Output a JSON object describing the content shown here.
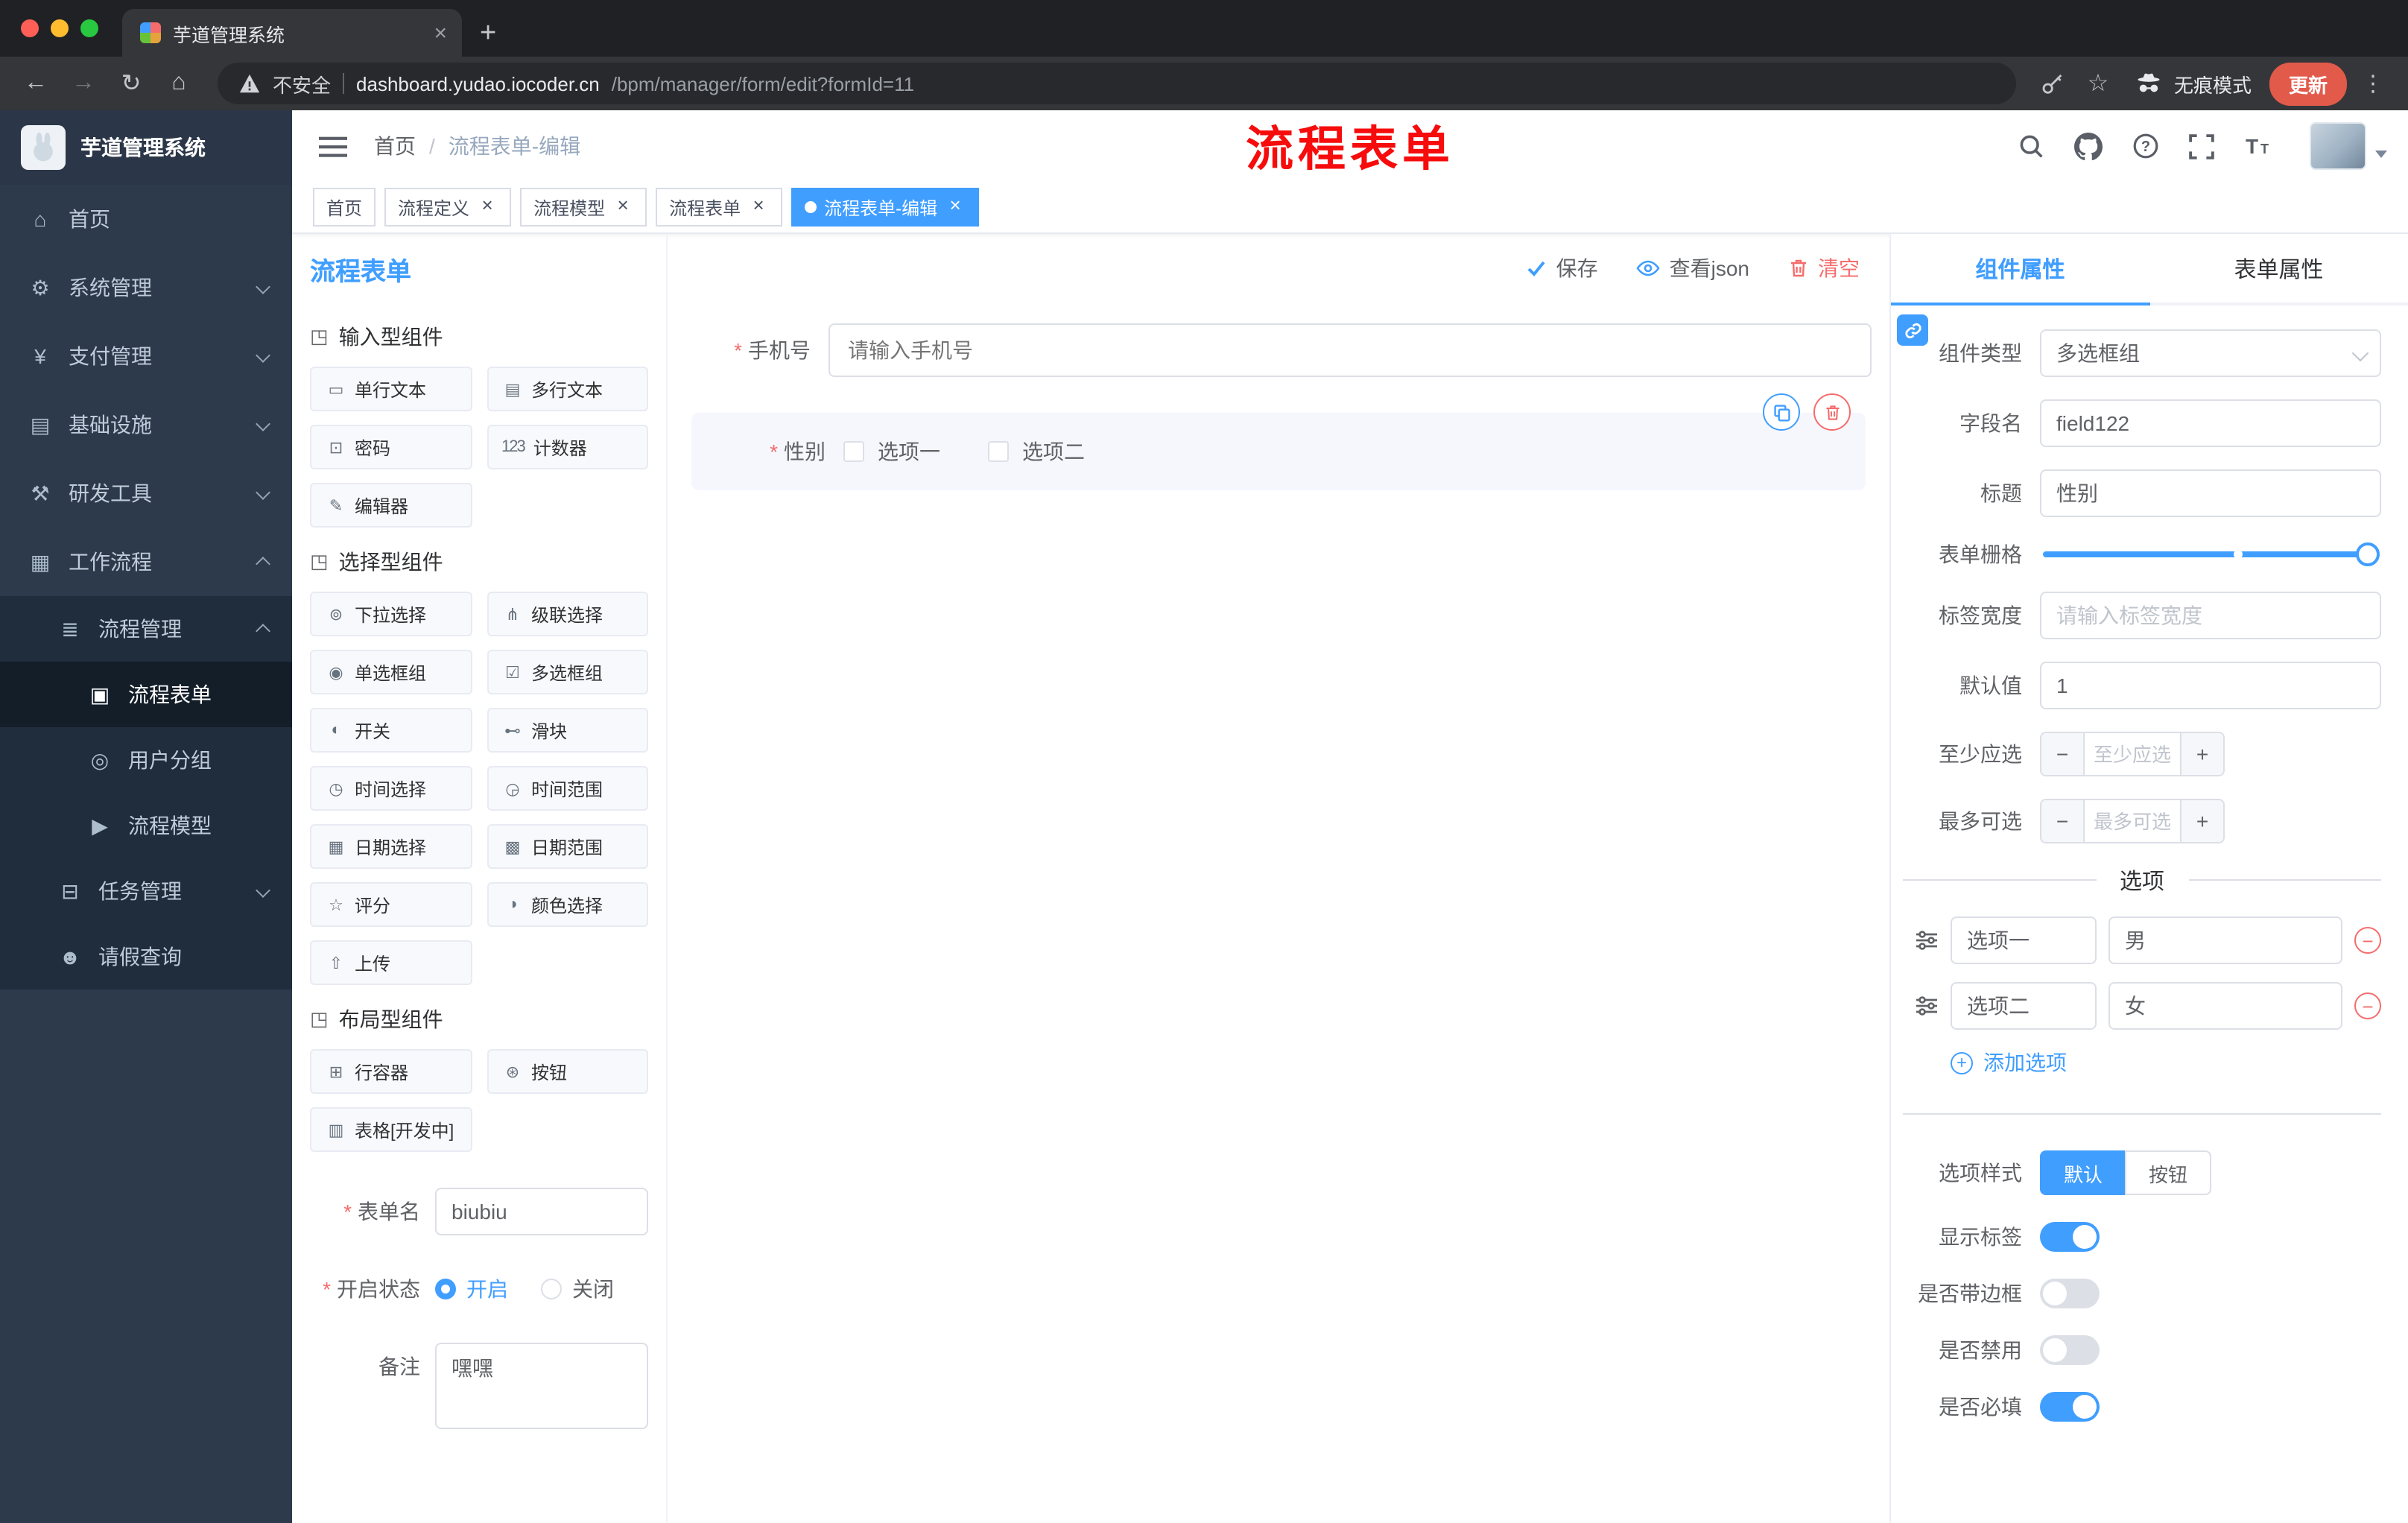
{
  "theme": {
    "accent": "#409EFF",
    "danger": "#F56C6C",
    "annotation_red": "#F60C0C",
    "sidebar_bg": "#2D3A4B"
  },
  "browser": {
    "tab_title": "芋道管理系统",
    "security_label": "不安全",
    "url_domain": "dashboard.yudao.iocoder.cn",
    "url_path": "/bpm/manager/form/edit?formId=11",
    "incognito_label": "无痕模式",
    "update_label": "更新"
  },
  "sidebar": {
    "logo_title": "芋道管理系统",
    "menu": [
      {
        "label": "首页",
        "icon": "home-icon"
      },
      {
        "label": "系统管理",
        "icon": "gear-icon"
      },
      {
        "label": "支付管理",
        "icon": "yen-icon"
      },
      {
        "label": "基础设施",
        "icon": "infra-icon"
      },
      {
        "label": "研发工具",
        "icon": "tool-icon"
      },
      {
        "label": "工作流程",
        "icon": "workflow-icon"
      },
      {
        "label": "流程管理",
        "icon": "list-icon"
      },
      {
        "label": "流程表单",
        "icon": "form-icon"
      },
      {
        "label": "用户分组",
        "icon": "users-icon"
      },
      {
        "label": "流程模型",
        "icon": "send-icon"
      },
      {
        "label": "任务管理",
        "icon": "task-icon"
      },
      {
        "label": "请假查询",
        "icon": "person-icon"
      }
    ]
  },
  "header": {
    "breadcrumb_home": "首页",
    "breadcrumb_sep": "/",
    "breadcrumb_current": "流程表单-编辑",
    "annotation": "流程表单"
  },
  "tags": [
    {
      "label": "首页"
    },
    {
      "label": "流程定义"
    },
    {
      "label": "流程模型"
    },
    {
      "label": "流程表单"
    },
    {
      "label": "流程表单-编辑"
    }
  ],
  "palette": {
    "title": "流程表单",
    "group_icon": "cube-icon",
    "group_input": "输入型组件",
    "group_select": "选择型组件",
    "group_layout": "布局型组件",
    "input_items": [
      {
        "label": "单行文本",
        "icon": "input-icon"
      },
      {
        "label": "多行文本",
        "icon": "textarea-icon"
      },
      {
        "label": "密码",
        "icon": "password-icon"
      },
      {
        "label": "计数器",
        "icon": "number-icon"
      },
      {
        "label": "编辑器",
        "icon": "editor-icon"
      }
    ],
    "select_items": [
      {
        "label": "下拉选择",
        "icon": "select-icon"
      },
      {
        "label": "级联选择",
        "icon": "cascader-icon"
      },
      {
        "label": "单选框组",
        "icon": "radio-icon"
      },
      {
        "label": "多选框组",
        "icon": "checkbox-icon"
      },
      {
        "label": "开关",
        "icon": "switch-icon"
      },
      {
        "label": "滑块",
        "icon": "slider-icon"
      },
      {
        "label": "时间选择",
        "icon": "time-icon"
      },
      {
        "label": "时间范围",
        "icon": "time-range-icon"
      },
      {
        "label": "日期选择",
        "icon": "date-icon"
      },
      {
        "label": "日期范围",
        "icon": "date-range-icon"
      },
      {
        "label": "评分",
        "icon": "rate-icon"
      },
      {
        "label": "颜色选择",
        "icon": "color-icon"
      },
      {
        "label": "上传",
        "icon": "upload-icon"
      }
    ],
    "layout_items": [
      {
        "label": "行容器",
        "icon": "row-icon"
      },
      {
        "label": "按钮",
        "icon": "button-icon"
      },
      {
        "label": "表格[开发中]",
        "icon": "table-icon"
      }
    ],
    "form": {
      "name_label": "表单名",
      "name_value": "biubiu",
      "status_label": "开启状态",
      "status_on": "开启",
      "status_off": "关闭",
      "remark_label": "备注",
      "remark_value": "嘿嘿"
    }
  },
  "canvas": {
    "save_label": "保存",
    "save_icon": "check-icon",
    "view_json_label": "查看json",
    "view_json_icon": "eye-icon",
    "clear_label": "清空",
    "clear_icon": "trash-icon",
    "phone": {
      "label": "手机号",
      "placeholder": "请输入手机号"
    },
    "gender": {
      "label": "性别",
      "option1": "选项一",
      "option2": "选项二"
    }
  },
  "props": {
    "tab_component": "组件属性",
    "tab_form": "表单属性",
    "type_label": "组件类型",
    "type_value": "多选框组",
    "field_label": "字段名",
    "field_value": "field122",
    "title_label": "标题",
    "title_value": "性别",
    "grid_label": "表单栅格",
    "width_label": "标签宽度",
    "width_placeholder": "请输入标签宽度",
    "default_label": "默认值",
    "default_value": "1",
    "min_label": "至少应选",
    "min_placeholder": "至少应选",
    "max_label": "最多可选",
    "max_placeholder": "最多可选",
    "options_title": "选项",
    "options": [
      {
        "label": "选项一",
        "value": "男"
      },
      {
        "label": "选项二",
        "value": "女"
      }
    ],
    "add_option": "添加选项",
    "style_label": "选项样式",
    "style_default": "默认",
    "style_button": "按钮",
    "show_label": "显示标签",
    "border_label": "是否带边框",
    "disabled_label": "是否禁用",
    "required_label": "是否必填"
  }
}
